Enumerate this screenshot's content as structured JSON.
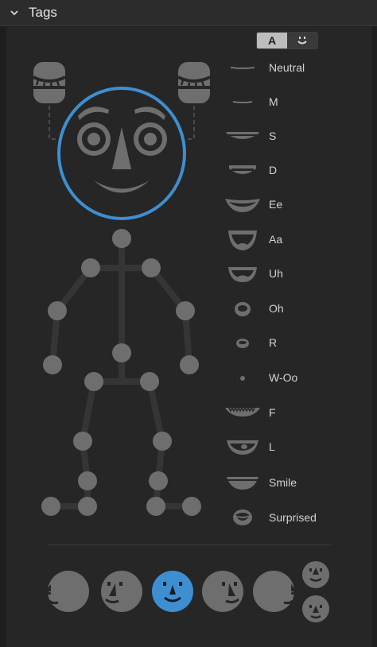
{
  "panel": {
    "title": "Tags"
  },
  "toggle": {
    "text_label": "A",
    "face_icon": "smile-face-icon"
  },
  "mouths": [
    {
      "label": "Neutral"
    },
    {
      "label": "M"
    },
    {
      "label": "S"
    },
    {
      "label": "D"
    },
    {
      "label": "Ee"
    },
    {
      "label": "Aa"
    },
    {
      "label": "Uh"
    },
    {
      "label": "Oh"
    },
    {
      "label": "R"
    },
    {
      "label": "W-Oo"
    },
    {
      "label": "F"
    },
    {
      "label": "L"
    },
    {
      "label": "Smile"
    },
    {
      "label": "Surprised"
    }
  ],
  "colors": {
    "accent": "#3d8fd1",
    "shape": "#6e6e6e",
    "bg": "#262626"
  },
  "views": [
    {
      "name": "left-profile-view",
      "selected": false
    },
    {
      "name": "left-quartered-view",
      "selected": false
    },
    {
      "name": "frontal-view",
      "selected": true
    },
    {
      "name": "right-quartered-view",
      "selected": false
    },
    {
      "name": "right-profile-view",
      "selected": false
    },
    {
      "name": "upward-view",
      "selected": false
    },
    {
      "name": "downward-view",
      "selected": false
    }
  ]
}
